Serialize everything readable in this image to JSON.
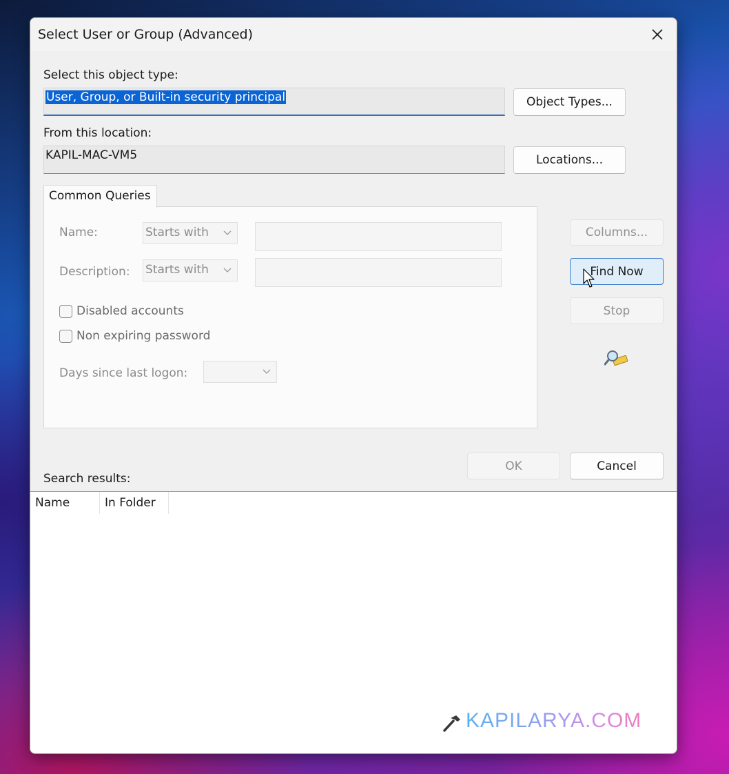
{
  "window": {
    "title": "Select User or Group (Advanced)"
  },
  "object_type": {
    "label": "Select this object type:",
    "value": "User, Group, or Built-in security principal",
    "button": "Object Types..."
  },
  "location": {
    "label": "From this location:",
    "value": "KAPIL-MAC-VM5",
    "button": "Locations..."
  },
  "queries": {
    "tab_label": "Common Queries",
    "name_label": "Name:",
    "name_mode": "Starts with",
    "description_label": "Description:",
    "description_mode": "Starts with",
    "disabled_accounts_label": "Disabled accounts",
    "non_expiring_label": "Non expiring password",
    "days_label": "Days since last logon:",
    "days_value": ""
  },
  "side_buttons": {
    "columns": "Columns...",
    "find_now": "Find Now",
    "stop": "Stop"
  },
  "footer": {
    "ok": "OK",
    "cancel": "Cancel",
    "results_label": "Search results:"
  },
  "results": {
    "columns": [
      "Name",
      "In Folder"
    ]
  },
  "watermark": {
    "text": "KAPILARYA.COM"
  },
  "colors": {
    "selection": "#0a64d4",
    "focus_accent": "#3a6fb7",
    "primary_button_border": "#3a7cc9"
  }
}
